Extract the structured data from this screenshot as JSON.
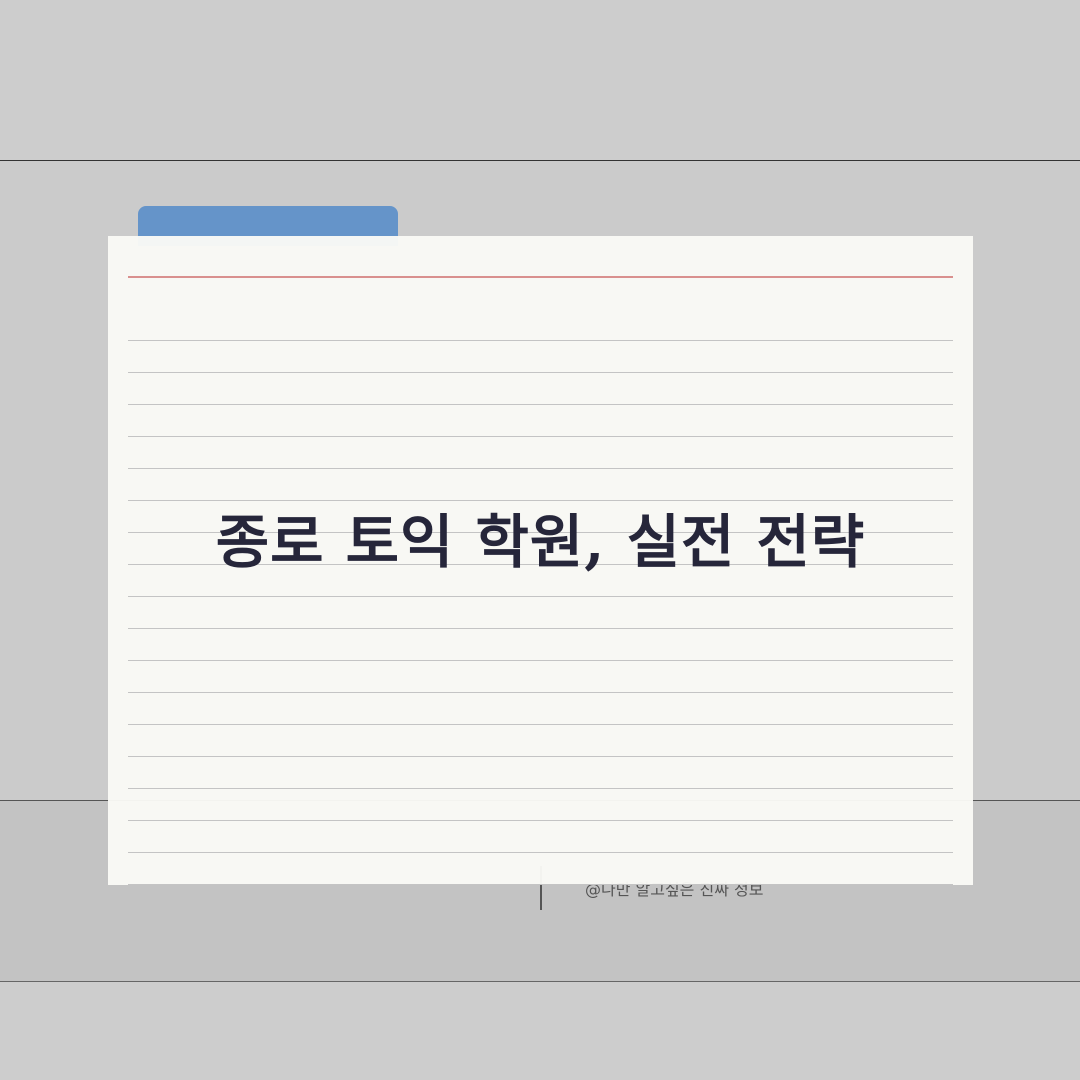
{
  "card": {
    "title": "종로 토익 학원, 실전 전략"
  },
  "footer": {
    "credit": "@나만 알고싶은 진짜 정보"
  },
  "colors": {
    "background": "#cdcdcd",
    "folder_tab": "#6594c9",
    "card": "#fafaf6",
    "margin_line": "#d9908e",
    "title_text": "#26263a"
  }
}
